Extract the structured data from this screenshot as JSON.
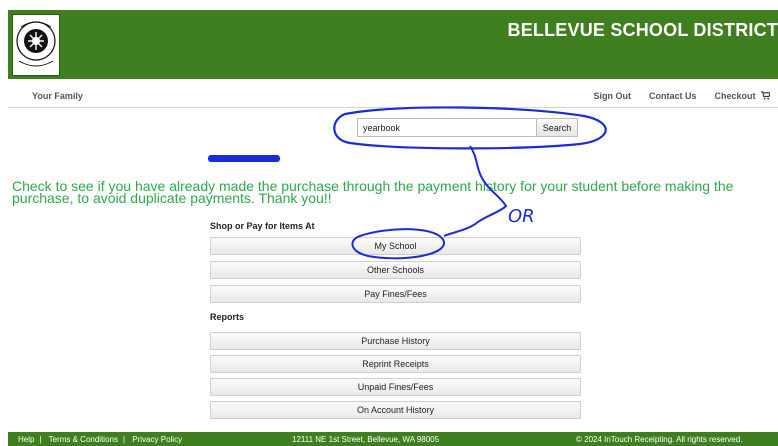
{
  "header": {
    "title": "BELLEVUE SCHOOL DISTRICT",
    "brand_color": "#3f7f1f"
  },
  "nav": {
    "left_label": "Your Family",
    "sign_out": "Sign Out",
    "contact_us": "Contact Us",
    "checkout": "Checkout",
    "cart_icon": "cart-icon"
  },
  "search": {
    "value": "yearbook",
    "button_label": "Search"
  },
  "notice": {
    "text": "Check to see if you have already made the purchase through the payment history for your student before making the purchase, to avoid duplicate payments. Thank you!!",
    "color": "#2fa84a"
  },
  "shop": {
    "heading": "Shop or Pay for Items At",
    "items": [
      "My School",
      "Other Schools",
      "Pay Fines/Fees"
    ]
  },
  "reports": {
    "heading": "Reports",
    "items": [
      "Purchase History",
      "Reprint Receipts",
      "Unpaid Fines/Fees",
      "On Account History"
    ]
  },
  "annotation": {
    "handwritten_text": "OR",
    "ink_color": "#1a2bd8"
  },
  "footer": {
    "help": "Help",
    "terms": "Terms & Conditions",
    "privacy": "Privacy Policy",
    "address": "12111 NE 1st Street, Bellevue, WA 98005",
    "copyright": "© 2024 InTouch Receipting. All rights reserved."
  }
}
